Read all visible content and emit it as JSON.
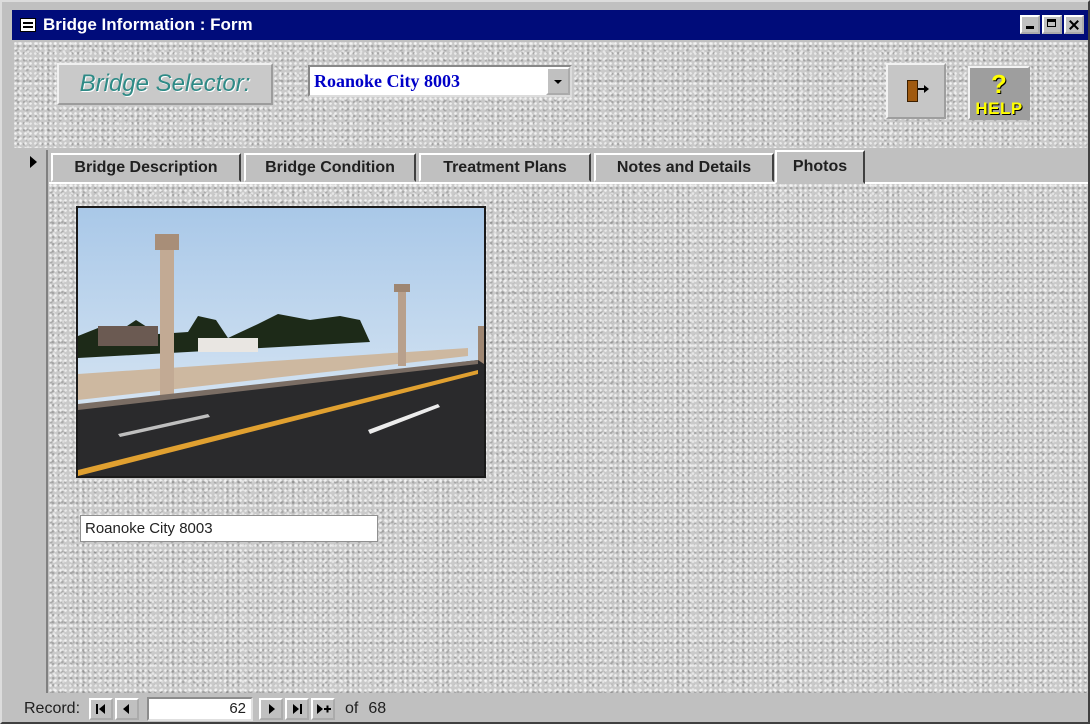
{
  "window": {
    "title": "Bridge Information : Form",
    "title_icon": "form-icon",
    "controls": [
      "minimize-icon",
      "maximize-icon",
      "close-icon"
    ]
  },
  "header": {
    "selector_label": "Bridge Selector:",
    "selected_bridge": "Roanoke City 8003",
    "exit_icon": "exit-door-icon",
    "help_label": "HELP",
    "help_symbol": "?"
  },
  "tabs": [
    {
      "label": "Bridge Description",
      "active": false
    },
    {
      "label": "Bridge Condition",
      "active": false
    },
    {
      "label": "Treatment Plans",
      "active": false
    },
    {
      "label": "Notes and Details",
      "active": false
    },
    {
      "label": "Photos",
      "active": true
    }
  ],
  "photos": {
    "caption": "Roanoke City 8003"
  },
  "record_nav": {
    "label": "Record:",
    "current": "62",
    "of_label": "of",
    "total": "68"
  },
  "colors": {
    "titlebar": "#000c7a",
    "selector_text": "#2e8a86",
    "combo_text": "#0000c8",
    "help_text": "#ffff00"
  }
}
